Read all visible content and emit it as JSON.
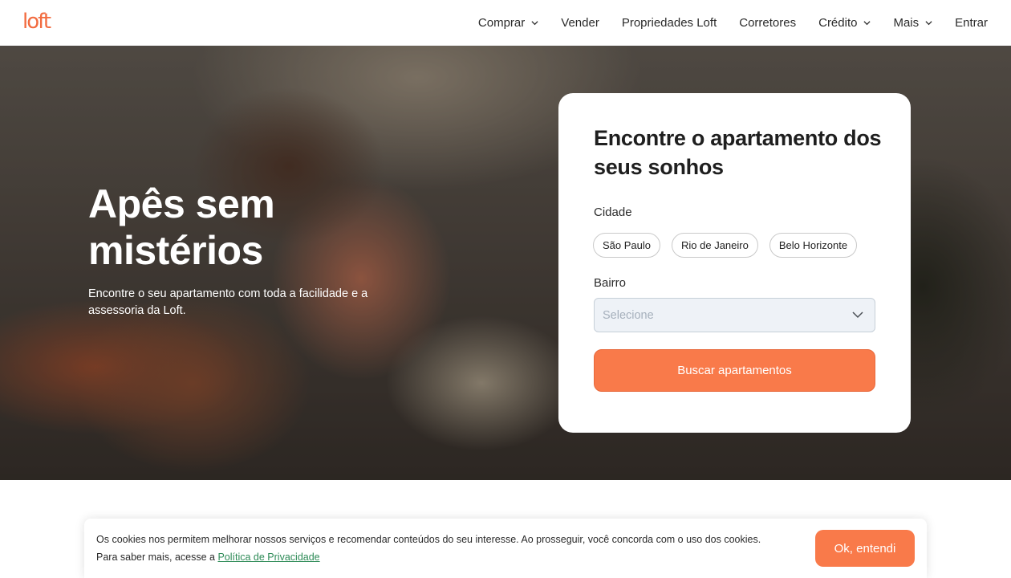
{
  "header": {
    "logo_text": "loft",
    "nav": [
      {
        "label": "Comprar",
        "has_dropdown": true
      },
      {
        "label": "Vender",
        "has_dropdown": false
      },
      {
        "label": "Propriedades Loft",
        "has_dropdown": false
      },
      {
        "label": "Corretores",
        "has_dropdown": false
      },
      {
        "label": "Crédito",
        "has_dropdown": true
      },
      {
        "label": "Mais",
        "has_dropdown": true
      },
      {
        "label": "Entrar",
        "has_dropdown": false
      }
    ]
  },
  "hero": {
    "title": "Apês sem mistérios",
    "subtitle": "Encontre o seu apartamento com toda a facilidade e a assessoria da Loft."
  },
  "search_card": {
    "title": "Encontre o apartamento dos seus sonhos",
    "city_label": "Cidade",
    "cities": [
      "São Paulo",
      "Rio de Janeiro",
      "Belo Horizonte"
    ],
    "neighborhood_label": "Bairro",
    "neighborhood_placeholder": "Selecione",
    "search_button": "Buscar apartamentos"
  },
  "cookie_banner": {
    "text": "Os cookies nos permitem melhorar nossos serviços e recomendar conteúdos do seu interesse. Ao prosseguir, você concorda com o uso dos cookies. Para saber mais, acesse a ",
    "link_text": "Política de Privacidade",
    "ok_button": "Ok, entendi"
  },
  "colors": {
    "accent": "#f97a4a",
    "logo": "#f26b3f",
    "link": "#2e8b57"
  }
}
